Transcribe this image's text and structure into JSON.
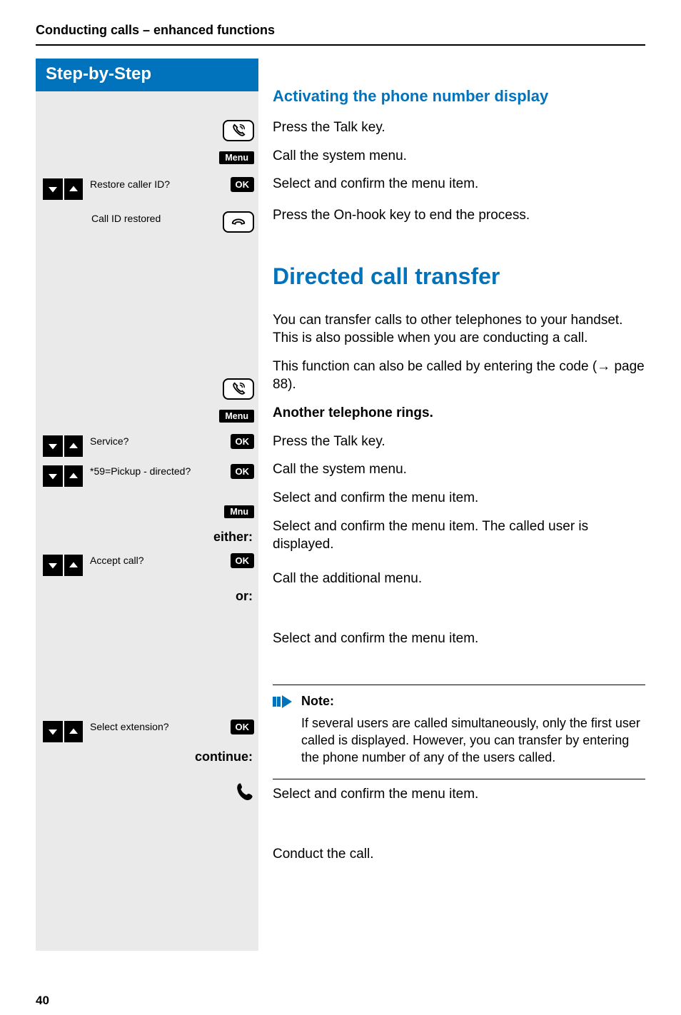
{
  "header": {
    "running_title": "Conducting calls – enhanced functions"
  },
  "sidebar": {
    "title": "Step-by-Step",
    "buttons": {
      "menu": "Menu",
      "ok": "OK",
      "mnu": "Mnu"
    },
    "step1_label": "Restore caller ID?",
    "step2_label": "Call ID restored",
    "step3_label": "Service?",
    "step4_label": "*59=Pickup - directed?",
    "step5_label": "Accept call?",
    "step6_label": "Select extension?",
    "choice_either": "either:",
    "choice_or": "or:",
    "choice_continue": "continue:"
  },
  "section1": {
    "title": "Activating the phone number display",
    "talk": "Press the Talk key.",
    "menu_call": "Call the system menu.",
    "select": "Select and confirm the menu item.",
    "onhook": "Press the On-hook key to end the process."
  },
  "section2": {
    "title": "Directed call transfer",
    "intro1": "You can transfer calls to other telephones to your handset. This is also possible when you are conducting a call.",
    "intro2_a": "This function can also be called by entering the code (",
    "intro2_arrow": "→",
    "intro2_b": " page 88).",
    "ring_head": "Another telephone rings.",
    "talk": "Press the Talk key.",
    "menu_call": "Call the system menu.",
    "select1": "Select and confirm the menu item.",
    "select2": "Select and confirm the menu item. The called user is displayed.",
    "mnu_call": "Call the additional menu.",
    "select3": "Select and confirm the menu item.",
    "note_head": "Note:",
    "note_body": "If several users are called simultaneously, only the first user called is displayed. However, you can transfer by entering the phone number of any of the users called.",
    "select4": "Select and confirm the menu item.",
    "conduct": "Conduct the call."
  },
  "footer": {
    "page": "40"
  }
}
